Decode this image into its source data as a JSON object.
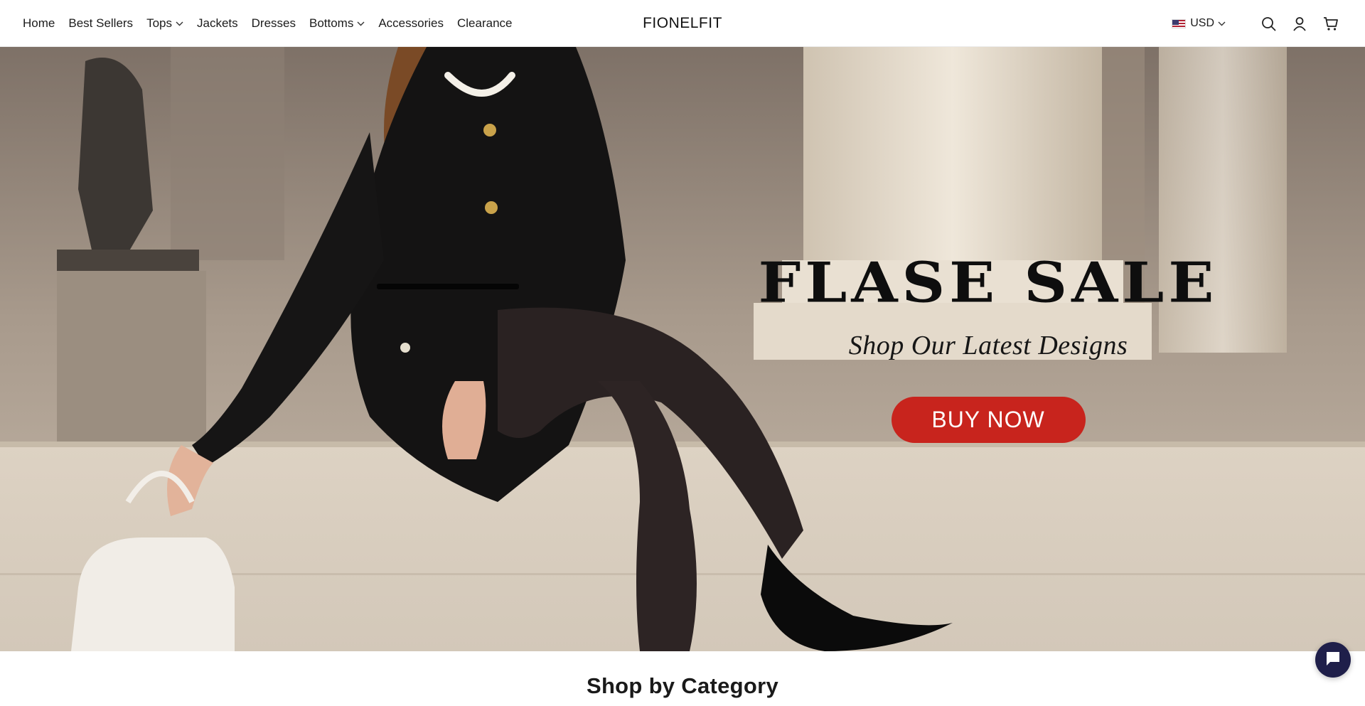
{
  "header": {
    "nav": [
      {
        "label": "Home",
        "has_dropdown": false
      },
      {
        "label": "Best Sellers",
        "has_dropdown": false
      },
      {
        "label": "Tops",
        "has_dropdown": true
      },
      {
        "label": "Jackets",
        "has_dropdown": false
      },
      {
        "label": "Dresses",
        "has_dropdown": false
      },
      {
        "label": "Bottoms",
        "has_dropdown": true
      },
      {
        "label": "Accessories",
        "has_dropdown": false
      },
      {
        "label": "Clearance",
        "has_dropdown": false
      }
    ],
    "brand": "FIONELFIT",
    "currency": {
      "label": "USD",
      "flag": "us-flag-icon"
    },
    "icons": [
      "search-icon",
      "account-icon",
      "cart-icon"
    ]
  },
  "hero": {
    "title": "FLASE SALE",
    "subtitle": "Shop Our Latest Designs",
    "cta_label": "BUY NOW",
    "cta_color": "#c8241d"
  },
  "category_section": {
    "title": "Shop by Category"
  },
  "chat": {
    "icon": "chat-icon",
    "color": "#1f1f4a"
  }
}
